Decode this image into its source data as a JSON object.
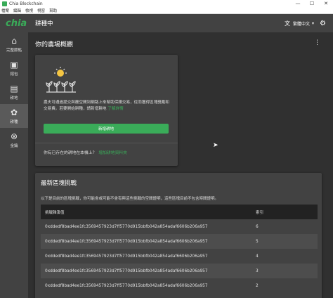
{
  "window": {
    "title": "Chia Blockchain",
    "controls": [
      "—",
      "☐",
      "✕"
    ]
  },
  "menu": [
    "檔案",
    "編輯",
    "檢視",
    "視窗",
    "幫助"
  ],
  "topbar": {
    "logo": "chia",
    "page_title": "耕種中",
    "language": "繁體中文"
  },
  "sidebar": {
    "items": [
      {
        "label": "完整節點",
        "icon": "home-icon",
        "glyph": "⌂"
      },
      {
        "label": "錢包",
        "icon": "wallet-icon",
        "glyph": "▣"
      },
      {
        "label": "耕地",
        "icon": "farm-icon",
        "glyph": "▤"
      },
      {
        "label": "耕種",
        "icon": "sprout-icon",
        "glyph": "✿"
      },
      {
        "label": "金鑰",
        "icon": "key-icon",
        "glyph": "⊗"
      }
    ],
    "active_index": 3
  },
  "main": {
    "heading": "你的農場概觀",
    "intro": {
      "description": "農夫可通過提交與覆空間到網路上來幫助保護交易，從而獲得區塊獎勵和交易費。若要開始耕種，請新增耕地",
      "learn_more": "了解詳情",
      "button_label": "新增耕地",
      "existing_prompt": "你有已存在的耕地在本機上？",
      "existing_link": "增加耕地資料夾"
    },
    "challenges": {
      "title": "最新區塊挑戰",
      "subtitle": "以下是目前的區塊挑戰，你可能會或可能不會有與這些挑戰的空間證明，這些區塊目前不包含時間證明。",
      "columns": [
        "挑戰雜湊值",
        "索引"
      ],
      "rows": [
        {
          "hash": "0xddedf8bad4ee1fc3569457923d7ff5770d915bbfb042a854adaf6606b206a957",
          "index": "6"
        },
        {
          "hash": "0xddedf8bad4ee1fc3569457923d7ff5770d915bbfb042a854adaf6606b206a957",
          "index": "5"
        },
        {
          "hash": "0xddedf8bad4ee1fc3569457923d7ff5770d915bbfb042a854adaf6606b206a957",
          "index": "4"
        },
        {
          "hash": "0xddedf8bad4ee1fc3569457923d7ff5770d915bbfb042a854adaf6606b206a957",
          "index": "3"
        },
        {
          "hash": "0xddedf8bad4ee1fc3569457923d7ff5770d915bbfb042a854adaf6606b206a957",
          "index": "2"
        }
      ]
    }
  },
  "colors": {
    "accent": "#3aac59",
    "surface": "#424242",
    "background": "#303030"
  }
}
